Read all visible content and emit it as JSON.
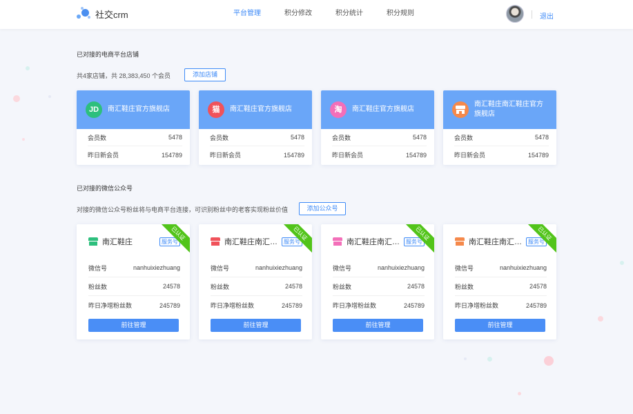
{
  "header": {
    "app_title": "社交crm",
    "nav": [
      "平台管理",
      "积分修改",
      "积分统计",
      "积分规则"
    ],
    "active_nav": 0,
    "logout": "退出"
  },
  "stores_section": {
    "title": "已对接的电商平台店铺",
    "summary": "共4家店铺，共 28,383,450 个会员",
    "add_button": "添加店铺",
    "stores": [
      {
        "name": "南汇鞋庄官方旗舰店",
        "icon_text": "JD",
        "icon_color": "#2dbf7d",
        "members_label": "会员数",
        "members": "5478",
        "new_label": "昨日新会员",
        "new_members": "154789"
      },
      {
        "name": "南汇鞋庄官方旗舰店",
        "icon_text": "猫",
        "icon_color": "#f0525a",
        "members_label": "会员数",
        "members": "5478",
        "new_label": "昨日新会员",
        "new_members": "154789"
      },
      {
        "name": "南汇鞋庄官方旗舰店",
        "icon_text": "淘",
        "icon_color": "#f36fb9",
        "members_label": "会员数",
        "members": "5478",
        "new_label": "昨日新会员",
        "new_members": "154789"
      },
      {
        "name": "南汇鞋庄南汇鞋庄官方旗舰店",
        "icon_text": "店",
        "icon_color": "#f5894b",
        "members_label": "会员数",
        "members": "5478",
        "new_label": "昨日新会员",
        "new_members": "154789"
      }
    ]
  },
  "wechat_section": {
    "title": "已对接的微信公众号",
    "summary": "对接的微信公众号粉丝将与电商平台连接，可识别粉丝中的老客实现粉丝价值",
    "add_button": "添加公众号",
    "accounts": [
      {
        "name": "南汇鞋庄",
        "icon_color": "#2dbf7d",
        "tag": "服务号",
        "ribbon": "已认证",
        "wx_label": "微信号",
        "wx_id": "nanhuixiezhuang",
        "fans_label": "粉丝数",
        "fans": "24578",
        "growth_label": "昨日净增粉丝数",
        "growth": "245789",
        "button": "前往管理"
      },
      {
        "name": "南汇鞋庄南汇鞋...",
        "icon_color": "#f0525a",
        "tag": "服务号",
        "ribbon": "已认证",
        "wx_label": "微信号",
        "wx_id": "nanhuixiezhuang",
        "fans_label": "粉丝数",
        "fans": "24578",
        "growth_label": "昨日净增粉丝数",
        "growth": "245789",
        "button": "前往管理"
      },
      {
        "name": "南汇鞋庄南汇鞋...",
        "icon_color": "#f36fb9",
        "tag": "服务号",
        "ribbon": "已认证",
        "wx_label": "微信号",
        "wx_id": "nanhuixiezhuang",
        "fans_label": "粉丝数",
        "fans": "24578",
        "growth_label": "昨日净增粉丝数",
        "growth": "245789",
        "button": "前往管理"
      },
      {
        "name": "南汇鞋庄南汇鞋...",
        "icon_color": "#f5894b",
        "tag": "服务号",
        "ribbon": "已认证",
        "wx_label": "微信号",
        "wx_id": "nanhuixiezhuang",
        "fans_label": "粉丝数",
        "fans": "24578",
        "growth_label": "昨日净增粉丝数",
        "growth": "245789",
        "button": "前往管理"
      }
    ]
  },
  "colors": {
    "accent": "#3d8af7",
    "card_header": "#6aa6f8",
    "verified": "#52c41a",
    "background": "#f4f6fb"
  }
}
